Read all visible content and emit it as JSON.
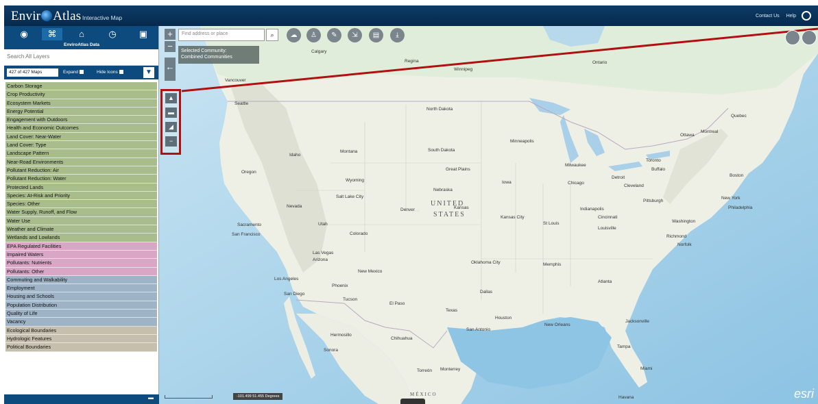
{
  "header": {
    "logo_text_left": "Envir",
    "logo_text_right": "Atlas",
    "subtitle": "Interactive Map",
    "links": [
      "Contact Us",
      "Help"
    ],
    "colors": {
      "header_bg": "#0d3b66"
    }
  },
  "panel": {
    "tabs": [
      {
        "icon": "globe-icon",
        "glyph": "◉"
      },
      {
        "icon": "data-icon",
        "glyph": "⌘"
      },
      {
        "icon": "community-icon",
        "glyph": "⌂"
      },
      {
        "icon": "history-icon",
        "glyph": "◷"
      },
      {
        "icon": "clipboard-icon",
        "glyph": "▣"
      }
    ],
    "tab_caption": "EnviroAtlas Data",
    "search_placeholder": "Search All Layers",
    "count_label": "427 of 427 Maps",
    "expand_label": "Expand",
    "hide_icons_label": "Hide Icons",
    "filter_icon": "funnel-icon",
    "footer_glyph": "▬",
    "layers": [
      {
        "label": "Carbon Storage",
        "group": "eco"
      },
      {
        "label": "Crop Productivity",
        "group": "eco"
      },
      {
        "label": "Ecosystem Markets",
        "group": "eco"
      },
      {
        "label": "Energy Potential",
        "group": "eco"
      },
      {
        "label": "Engagement with Outdoors",
        "group": "eco"
      },
      {
        "label": "Health and Economic Outcomes",
        "group": "eco"
      },
      {
        "label": "Land Cover: Near-Water",
        "group": "eco"
      },
      {
        "label": "Land Cover: Type",
        "group": "eco"
      },
      {
        "label": "Landscape Pattern",
        "group": "eco"
      },
      {
        "label": "Near-Road Environments",
        "group": "eco"
      },
      {
        "label": "Pollutant Reduction: Air",
        "group": "eco"
      },
      {
        "label": "Pollutant Reduction: Water",
        "group": "eco"
      },
      {
        "label": "Protected Lands",
        "group": "eco"
      },
      {
        "label": "Species: At-Risk and Priority",
        "group": "eco"
      },
      {
        "label": "Species: Other",
        "group": "eco"
      },
      {
        "label": "Water Supply, Runoff, and Flow",
        "group": "eco"
      },
      {
        "label": "Water Use",
        "group": "eco"
      },
      {
        "label": "Weather and Climate",
        "group": "eco"
      },
      {
        "label": "Wetlands and Lowlands",
        "group": "eco"
      },
      {
        "label": "EPA Regulated Facilities",
        "group": "epa"
      },
      {
        "label": "Impaired Waters",
        "group": "epa"
      },
      {
        "label": "Pollutants: Nutrients",
        "group": "epa"
      },
      {
        "label": "Pollutants: Other",
        "group": "epa"
      },
      {
        "label": "Commuting and Walkability",
        "group": "people"
      },
      {
        "label": "Employment",
        "group": "people"
      },
      {
        "label": "Housing and Schools",
        "group": "people"
      },
      {
        "label": "Population Distribution",
        "group": "people"
      },
      {
        "label": "Quality of Life",
        "group": "people"
      },
      {
        "label": "Vacancy",
        "group": "people"
      },
      {
        "label": "Ecological Boundaries",
        "group": "bound"
      },
      {
        "label": "Hydrologic Features",
        "group": "bound"
      },
      {
        "label": "Political Boundaries",
        "group": "bound"
      }
    ]
  },
  "map": {
    "search_placeholder": "Find address or place",
    "search_icon": "magnifier-icon",
    "zoom_in": "+",
    "zoom_out": "−",
    "back_glyph": "←",
    "community_line1": "Selected Community:",
    "community_line2": "Combined Communities",
    "tools": [
      "cloud-icon",
      "people-icon",
      "pen-icon",
      "measure-icon",
      "print-icon",
      "download-icon"
    ],
    "tool_glyphs": [
      "☁",
      "♙",
      "✎",
      "⇲",
      "▤",
      "⤓"
    ],
    "side_tools": [
      "layer-icon",
      "usa-icon",
      "region-icon",
      "minimize-icon"
    ],
    "side_glyphs": [
      "▲",
      "▬",
      "◢",
      "−"
    ],
    "coords": "-101.499 51.455 Degrees",
    "attribution": "esri",
    "callout_color": "#b01010",
    "country_line1": "UNITED",
    "country_line2": "STATES",
    "country_mexico": "MÉXICO",
    "places": [
      {
        "name": "Calgary"
      },
      {
        "name": "Regina"
      },
      {
        "name": "Winnipeg"
      },
      {
        "name": "Vancouver"
      },
      {
        "name": "Seattle"
      },
      {
        "name": "North Dakota"
      },
      {
        "name": "South Dakota"
      },
      {
        "name": "Great Plains"
      },
      {
        "name": "Minneapolis"
      },
      {
        "name": "Milwaukee"
      },
      {
        "name": "Chicago"
      },
      {
        "name": "Detroit"
      },
      {
        "name": "Toronto"
      },
      {
        "name": "Buffalo"
      },
      {
        "name": "Ottawa"
      },
      {
        "name": "Montreal"
      },
      {
        "name": "Quebec"
      },
      {
        "name": "Boston"
      },
      {
        "name": "New York"
      },
      {
        "name": "Philadelphia"
      },
      {
        "name": "Pittsburgh"
      },
      {
        "name": "Cleveland"
      },
      {
        "name": "Washington"
      },
      {
        "name": "Richmond"
      },
      {
        "name": "Norfolk"
      },
      {
        "name": "Indianapolis"
      },
      {
        "name": "Cincinnati"
      },
      {
        "name": "Louisville"
      },
      {
        "name": "St Louis"
      },
      {
        "name": "Kansas City"
      },
      {
        "name": "Denver"
      },
      {
        "name": "Salt Lake City"
      },
      {
        "name": "Sacramento"
      },
      {
        "name": "San Francisco"
      },
      {
        "name": "Las Vegas"
      },
      {
        "name": "Los Angeles"
      },
      {
        "name": "San Diego"
      },
      {
        "name": "Phoenix"
      },
      {
        "name": "Tucson"
      },
      {
        "name": "El Paso"
      },
      {
        "name": "Oklahoma City"
      },
      {
        "name": "Memphis"
      },
      {
        "name": "Dallas"
      },
      {
        "name": "Atlanta"
      },
      {
        "name": "Texas"
      },
      {
        "name": "San Antonio"
      },
      {
        "name": "Houston"
      },
      {
        "name": "New Orleans"
      },
      {
        "name": "Jacksonville"
      },
      {
        "name": "Tampa"
      },
      {
        "name": "Miami"
      },
      {
        "name": "Hermosillo"
      },
      {
        "name": "Chihuahua"
      },
      {
        "name": "Torreón"
      },
      {
        "name": "Monterrey"
      },
      {
        "name": "Havana"
      },
      {
        "name": "Nebraska"
      },
      {
        "name": "Kansas"
      },
      {
        "name": "Iowa"
      },
      {
        "name": "Nevada"
      },
      {
        "name": "Utah"
      },
      {
        "name": "Colorado"
      },
      {
        "name": "New Mexico"
      },
      {
        "name": "Wyoming"
      },
      {
        "name": "Montana"
      },
      {
        "name": "Idaho"
      },
      {
        "name": "Oregon"
      },
      {
        "name": "Arizona"
      },
      {
        "name": "Sonora"
      },
      {
        "name": "Ontario"
      }
    ]
  }
}
